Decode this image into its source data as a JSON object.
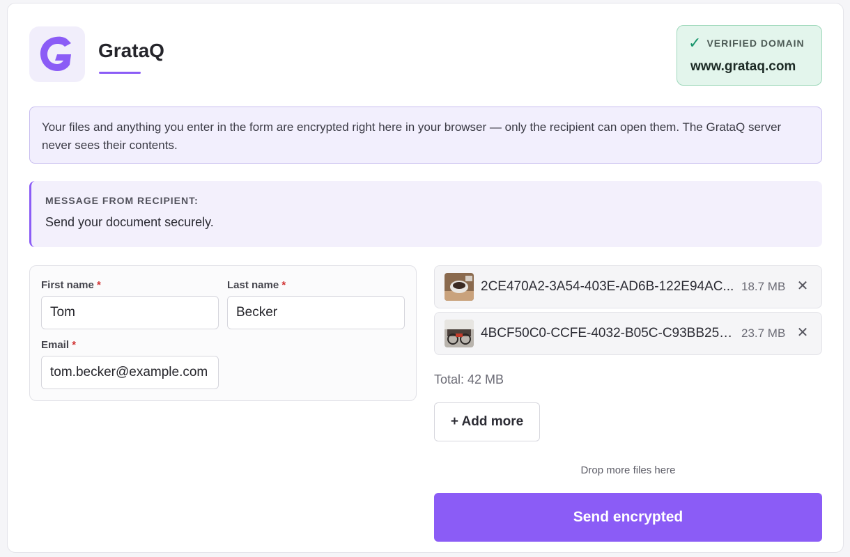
{
  "header": {
    "brand": "GrataQ",
    "verified_label": "VERIFIED DOMAIN",
    "verified_domain": "www.grataq.com",
    "icons": {
      "logo": "grataq-logo",
      "verified": "check-icon"
    }
  },
  "notice": {
    "text": "Your files and anything you enter in the form are encrypted right here in your browser — only the recipient can open them. The GrataQ server never sees their contents."
  },
  "recipient_message": {
    "label": "MESSAGE FROM RECIPIENT:",
    "text": "Send your document securely."
  },
  "form": {
    "first_name": {
      "label": "First name",
      "required_mark": "*",
      "value": "Tom"
    },
    "last_name": {
      "label": "Last name",
      "required_mark": "*",
      "value": "Becker"
    },
    "email": {
      "label": "Email",
      "required_mark": "*",
      "value": "tom.becker@example.com"
    }
  },
  "files": [
    {
      "name": "2CE470A2-3A54-403E-AD6B-122E94AC...",
      "size": "18.7 MB",
      "thumb": "coffee-photo-thumbnail"
    },
    {
      "name": "4BCF50C0-CCFE-4032-B05C-C93BB253...",
      "size": "23.7 MB",
      "thumb": "bicycles-photo-thumbnail"
    }
  ],
  "total": "Total: 42 MB",
  "add_more": "+ Add more",
  "drop_hint": "Drop more files here",
  "send": "Send encrypted",
  "colors": {
    "accent": "#8b5cf6",
    "verified_bg": "#e3f5ec",
    "verified_check": "#15936a",
    "required": "#d03030"
  }
}
